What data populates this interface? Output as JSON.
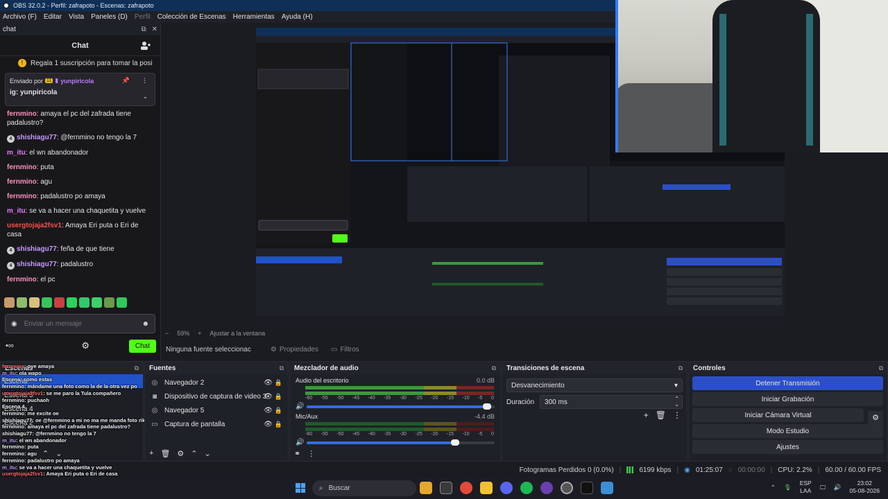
{
  "window": {
    "title": "OBS 32.0.2 - Perfil: zafrapoto - Escenas: zafrapoto"
  },
  "menu": [
    "Archivo (F)",
    "Editar",
    "Vista",
    "Paneles (D)",
    "Perfil",
    "Colección de Escenas",
    "Herramientas",
    "Ayuda (H)"
  ],
  "chat": {
    "dock_title": "chat",
    "header": "Chat",
    "sub_banner": "Regala 1 suscripción para tomar la posi",
    "pinned": {
      "label": "Enviado por",
      "badge": "11",
      "user": "yunpiricola",
      "message": "ig: yunpiricola"
    },
    "messages": [
      {
        "user": "fernmino",
        "color": "#ff8fbf",
        "badge": "",
        "text": "amaya el pc del zafrada tiene padalustro?"
      },
      {
        "user": "shishiagu77",
        "color": "#c79aff",
        "badge": "4",
        "text": "@fernmino no tengo la 7"
      },
      {
        "user": "m_itu",
        "color": "#e57cff",
        "badge": "",
        "text": "el wn abandonador"
      },
      {
        "user": "fernmino",
        "color": "#ff8fbf",
        "badge": "",
        "text": "puta"
      },
      {
        "user": "fernmino",
        "color": "#ff8fbf",
        "badge": "",
        "text": "agu"
      },
      {
        "user": "fernmino",
        "color": "#ff8fbf",
        "badge": "",
        "text": "padalustro po amaya"
      },
      {
        "user": "m_itu",
        "color": "#e57cff",
        "badge": "",
        "text": "se va a hacer una chaquetita y vuelve"
      },
      {
        "user": "usergtojaja2fsv1",
        "color": "#ff4d4d",
        "badge": "",
        "text": "Amaya Eri puta o Eri de casa"
      },
      {
        "user": "shishiagu77",
        "color": "#c79aff",
        "badge": "4",
        "text": "feña de que tiene"
      },
      {
        "user": "shishiagu77",
        "color": "#c79aff",
        "badge": "4",
        "text": "padalustro"
      },
      {
        "user": "fernmino",
        "color": "#ff8fbf",
        "badge": "",
        "text": "el pc"
      }
    ],
    "input_placeholder": "Enviar un mensaje",
    "send_label": "Chat"
  },
  "preview": {
    "zoom": "59%",
    "fit_label": "Ajustar a la ventana",
    "no_source": "Ninguna fuente seleccionac",
    "properties_label": "Propiedades",
    "filters_label": "Filtros"
  },
  "scenes": {
    "title": "Escenas",
    "items": [
      "Escena",
      "Escena 3",
      "Escena 4",
      "Escena 2"
    ],
    "overlay_lines": [
      {
        "u": "fernmino",
        "c": "r",
        "t": ": oye amaya"
      },
      {
        "u": "m_itu",
        "c": "p",
        "t": ": ola wapo"
      },
      {
        "u": "Escena",
        "c": "",
        "t": ": como estas"
      },
      {
        "u": "fernmino",
        "c": "",
        "t": ": mándame una foto como la de la otra vez po"
      },
      {
        "u": "usergtojaja2fsv1",
        "c": "r",
        "t": ": se me paro la Tula compañero"
      },
      {
        "u": "fernmino",
        "c": "",
        "t": ": puchaoh"
      },
      {
        "u": "Escena 4",
        "c": "",
        "t": ""
      },
      {
        "u": "fernmino",
        "c": "",
        "t": ": me excite oe"
      },
      {
        "u": "shishiagu77",
        "c": "",
        "t": ": oe @fernmino a mi no ma me manda foto rika"
      },
      {
        "u": "fernmino",
        "c": "",
        "t": ": amaya el pc del zafrada tiene padalustro?"
      },
      {
        "u": "shishiagu77",
        "c": "",
        "t": ": @fernmino no tengo la 7"
      },
      {
        "u": "m_itu",
        "c": "p",
        "t": ": el wn abandonador"
      },
      {
        "u": "fernmino",
        "c": "",
        "t": ": puta"
      },
      {
        "u": "fernmino",
        "c": "",
        "t": ": agu"
      },
      {
        "u": "fernmino",
        "c": "",
        "t": ": padalustro po amaya"
      },
      {
        "u": "m_itu",
        "c": "p",
        "t": ": se va a hacer una chaquetita y vuelve"
      },
      {
        "u": "usergtojaja2fsv1",
        "c": "r",
        "t": ": Amaya Eri puta o Eri de casa"
      },
      {
        "u": "shishiagu77",
        "c": "",
        "t": ": feña de que tiene"
      },
      {
        "u": "shishiagu77",
        "c": "",
        "t": ": padalustro"
      },
      {
        "u": "fernmino",
        "c": "",
        "t": ": el pc"
      }
    ]
  },
  "sources": {
    "title": "Fuentes",
    "items": [
      {
        "label": "Navegador 2",
        "icon": "globe-icon"
      },
      {
        "label": "Dispositivo de captura de video 3",
        "icon": "camera-icon"
      },
      {
        "label": "Navegador 5",
        "icon": "globe-icon"
      },
      {
        "label": "Captura de pantalla",
        "icon": "monitor-icon"
      }
    ]
  },
  "mixer": {
    "title": "Mezclador de audio",
    "channels": [
      {
        "name": "Audio del escritorio",
        "db": "0.0 dB",
        "volume": 0.96
      },
      {
        "name": "Mic/Aux",
        "db": "-4.4 dB",
        "volume": 0.79
      }
    ],
    "scale": [
      "-60",
      "-55",
      "-50",
      "-45",
      "-40",
      "-35",
      "-30",
      "-25",
      "-20",
      "-15",
      "-10",
      "-5",
      "0"
    ]
  },
  "transitions": {
    "title": "Transiciones de escena",
    "selected": "Desvanecimiento",
    "duration_label": "Duración",
    "duration_value": "300 ms"
  },
  "controls": {
    "title": "Controles",
    "buttons": [
      "Detener Transmisión",
      "Iniciar Grabación",
      "Iniciar Cámara Virtual",
      "Modo Estudio",
      "Ajustes"
    ]
  },
  "status": {
    "dropped": "Fotogramas Perdidos 0 (0.0%)",
    "bitrate": "6199 kbps",
    "stream_time": "01:25:07",
    "rec_time": "00:00:00",
    "cpu": "CPU: 2.2%",
    "fps": "60.00 / 60.00 FPS"
  },
  "taskbar": {
    "search": "Buscar",
    "lang_top": "ESP",
    "lang_bottom": "LAA",
    "time": "23:02",
    "date": "05-08-2026"
  }
}
